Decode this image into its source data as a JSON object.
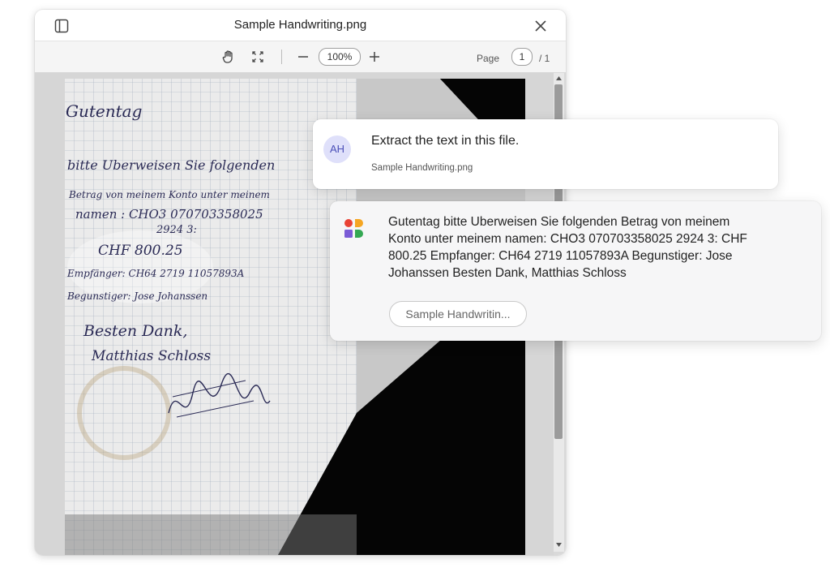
{
  "viewer": {
    "title": "Sample Handwriting.png",
    "zoom": "100%",
    "page_label": "Page",
    "current_page": "1",
    "page_total": "/ 1",
    "scroll_position_fraction": 0.0,
    "icons": [
      "sidebar-toggle-icon",
      "close-icon",
      "hand-pan-icon",
      "fit-screen-icon",
      "zoom-out-icon",
      "zoom-in-icon",
      "scroll-up-icon",
      "scroll-down-icon"
    ]
  },
  "document": {
    "handwriting_lines": [
      "Gutentag",
      "bitte Uberweisen Sie folgenden",
      "Betrag von meinem Konto unter meinem",
      "namen : CHO3 070703358025",
      "2924 3:",
      "CHF 800.25",
      "Empfänger: CH64 2719 11057893A",
      "Begunstiger: Jose Johanssen",
      "Besten Dank,",
      "Matthias Schloss"
    ]
  },
  "chat": {
    "user": {
      "avatar_initials": "AH",
      "message": "Extract the text in this file.",
      "attachment": "Sample Handwriting.png"
    },
    "assistant": {
      "message_lines": [
        "Gutentag bitte Uberweisen Sie folgenden Betrag von meinem",
        "Konto unter meinem namen: CHO3 070703358025 2924 3: CHF",
        "800.25 Empfanger: CH64 2719 11057893A Begunstiger: Jose",
        "Johanssen Besten Dank, Matthias Schloss"
      ],
      "file_chip": "Sample Handwritin...",
      "logo_colors": [
        "#e94235",
        "#f5a623",
        "#7b5cd6",
        "#34a853"
      ]
    }
  },
  "colors": {
    "accent_avatar_bg": "#dfe0fa",
    "accent_avatar_text": "#4b4fb8"
  }
}
